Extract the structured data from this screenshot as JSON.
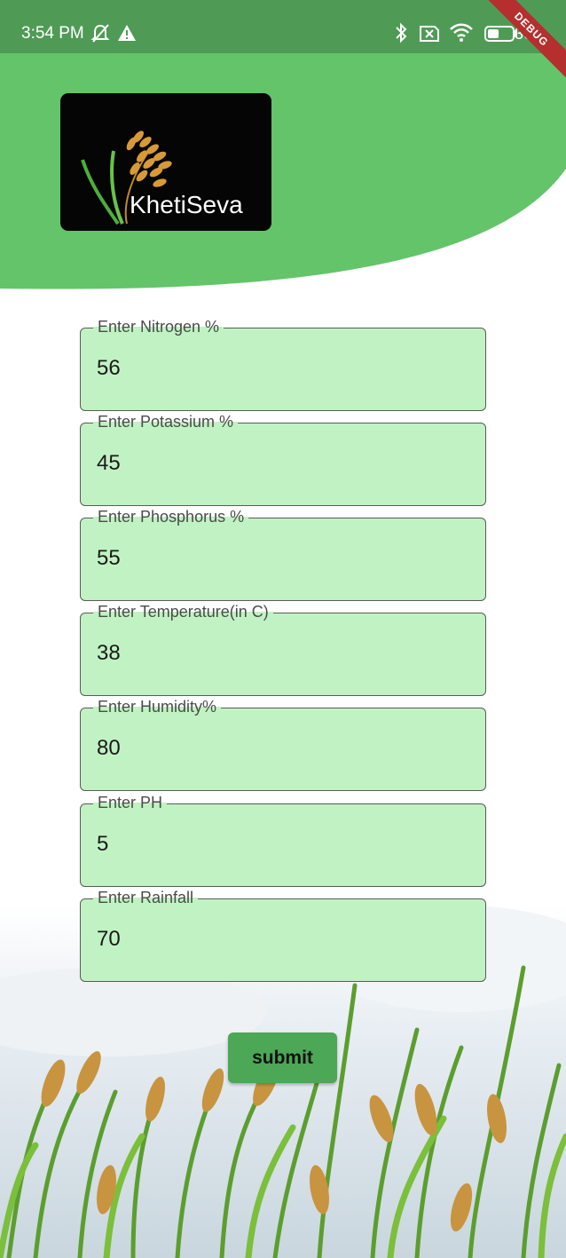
{
  "status_bar": {
    "time": "3:54 PM",
    "battery": "36",
    "icons_left": [
      "bell-off-icon",
      "warning-icon"
    ],
    "icons_right": [
      "bluetooth-icon",
      "sim-off-icon",
      "wifi-icon",
      "battery-icon"
    ],
    "debug_banner": "DEBUG"
  },
  "header": {
    "logo_text": "KhetiSeva",
    "accent_color": "#63c46a"
  },
  "form": {
    "fields": [
      {
        "label": "Enter Nitrogen %",
        "value": "56"
      },
      {
        "label": "Enter Potassium %",
        "value": "45"
      },
      {
        "label": "Enter Phosphorus %",
        "value": "55"
      },
      {
        "label": "Enter Temperature(in C)",
        "value": "38"
      },
      {
        "label": "Enter Humidity%",
        "value": "80"
      },
      {
        "label": "Enter PH",
        "value": "5"
      },
      {
        "label": "Enter Rainfall",
        "value": "70"
      }
    ],
    "submit_label": "submit",
    "field_fill_color": "#c1f2c3",
    "button_color": "#4ca756"
  }
}
